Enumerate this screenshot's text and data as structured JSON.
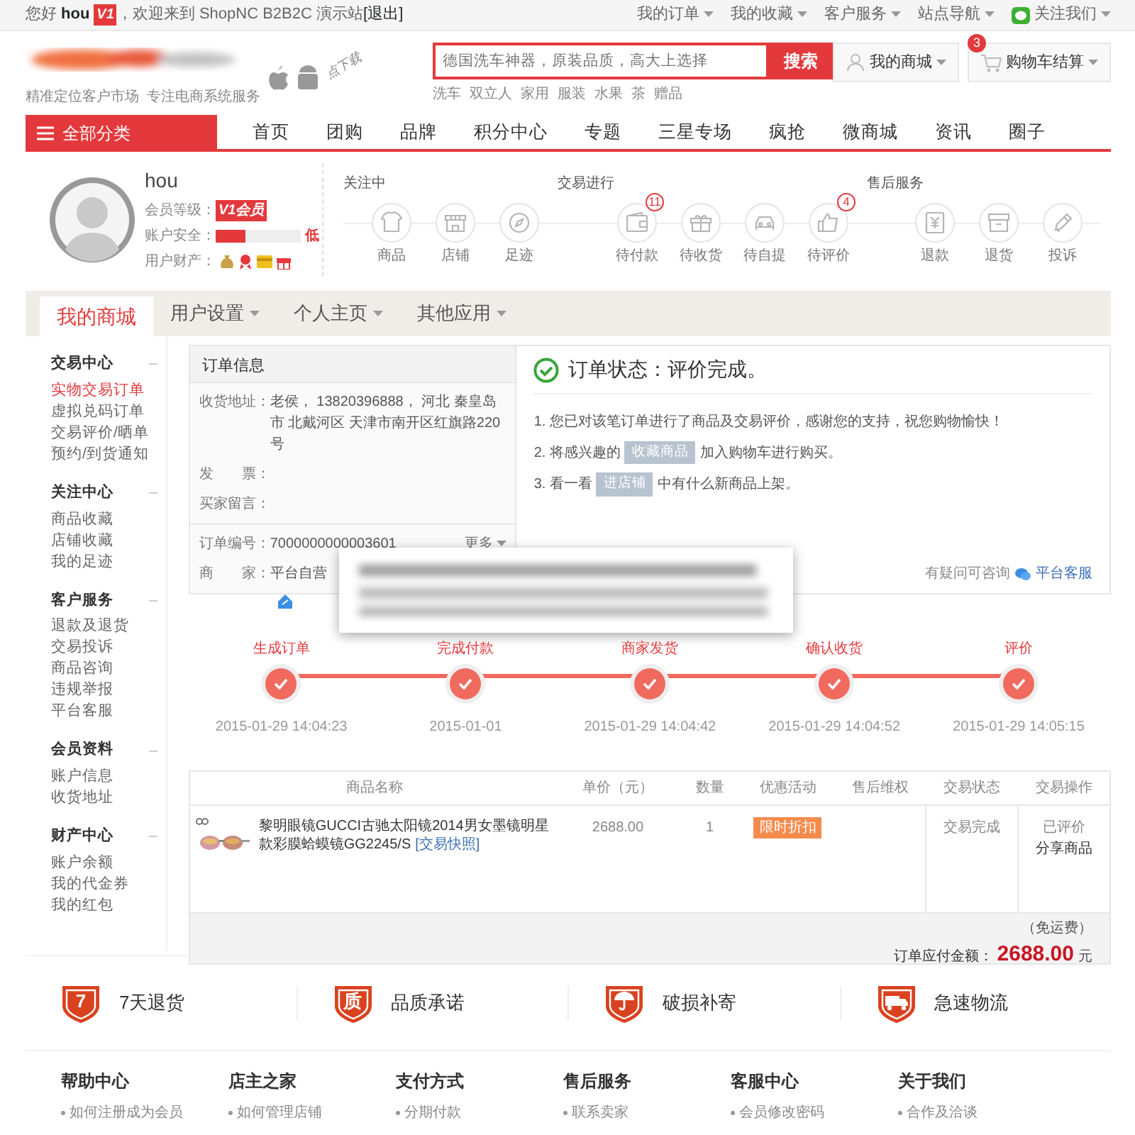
{
  "top_bar": {
    "greeting": "您好",
    "user": "hou",
    "level_badge": "V1",
    "welcome": "，欢迎来到 ShopNC B2B2C 演示站",
    "logout": "[退出]",
    "links": [
      "我的订单",
      "我的收藏",
      "客户服务",
      "站点导航"
    ],
    "follow": "关注我们"
  },
  "header": {
    "slogan": "精准定位客户市场  专注电商系统服务",
    "app_note": "点下载",
    "search": {
      "placeholder": "德国洗车神器，原装品质，高大上选择",
      "button": "搜索",
      "hot_words": [
        "洗车",
        "双立人",
        "家用",
        "服装",
        "水果",
        "茶",
        "赠品"
      ]
    },
    "my_mall": "我的商城",
    "cart": {
      "label": "购物车结算",
      "count": "3"
    }
  },
  "nav": {
    "category": "全部分类",
    "items": [
      "首页",
      "团购",
      "品牌",
      "积分中心",
      "专题",
      "三星专场",
      "疯抢",
      "微商城",
      "资讯",
      "圈子"
    ]
  },
  "profile": {
    "name": "hou",
    "level_label": "会员等级：",
    "level_badge": "V1会员",
    "security_label": "账户安全：",
    "security": {
      "level": 0.35,
      "reading": "低"
    },
    "assets_label": "用户财产："
  },
  "shortcut_groups": [
    {
      "title": "关注中",
      "items": [
        {
          "label": "商品",
          "kind": "shirt"
        },
        {
          "label": "店铺",
          "kind": "store"
        },
        {
          "label": "足迹",
          "kind": "compass"
        }
      ]
    },
    {
      "title": "交易进行",
      "items": [
        {
          "label": "待付款",
          "kind": "wallet",
          "count": "11"
        },
        {
          "label": "待收货",
          "kind": "gift"
        },
        {
          "label": "待自提",
          "kind": "car"
        },
        {
          "label": "待评价",
          "kind": "thumb",
          "count": "4"
        }
      ]
    },
    {
      "title": "售后服务",
      "items": [
        {
          "label": "退款",
          "kind": "refund"
        },
        {
          "label": "退货",
          "kind": "box"
        },
        {
          "label": "投诉",
          "kind": "pen"
        }
      ]
    }
  ],
  "tabs": [
    {
      "label": "我的商城",
      "selected": true,
      "dropdown": false
    },
    {
      "label": "用户设置",
      "selected": false,
      "dropdown": true
    },
    {
      "label": "个人主页",
      "selected": false,
      "dropdown": true
    },
    {
      "label": "其他应用",
      "selected": false,
      "dropdown": true
    }
  ],
  "sidebar": [
    {
      "title": "交易中心",
      "items": [
        {
          "label": "实物交易订单",
          "selected": true
        },
        {
          "label": "虚拟兑码订单",
          "selected": false
        },
        {
          "label": "交易评价/晒单",
          "selected": false
        },
        {
          "label": "预约/到货通知",
          "selected": false
        }
      ]
    },
    {
      "title": "关注中心",
      "items": [
        {
          "label": "商品收藏",
          "selected": false
        },
        {
          "label": "店铺收藏",
          "selected": false
        },
        {
          "label": "我的足迹",
          "selected": false
        }
      ]
    },
    {
      "title": "客户服务",
      "items": [
        {
          "label": "退款及退货",
          "selected": false
        },
        {
          "label": "交易投诉",
          "selected": false
        },
        {
          "label": "商品咨询",
          "selected": false
        },
        {
          "label": "违规举报",
          "selected": false
        },
        {
          "label": "平台客服",
          "selected": false
        }
      ]
    },
    {
      "title": "会员资料",
      "items": [
        {
          "label": "账户信息",
          "selected": false
        },
        {
          "label": "收货地址",
          "selected": false
        }
      ]
    },
    {
      "title": "财产中心",
      "items": [
        {
          "label": "账户余额",
          "selected": false
        },
        {
          "label": "我的代金券",
          "selected": false
        },
        {
          "label": "我的红包",
          "selected": false
        }
      ]
    }
  ],
  "order_info": {
    "title": "订单信息",
    "fields": [
      {
        "label": "收货地址：",
        "value": "老侯， 13820396888， 河北 秦皇岛市 北戴河区 天津市南开区红旗路220号"
      },
      {
        "label": "发　　票："
      },
      {
        "label": "买家留言："
      }
    ],
    "order_number": {
      "label": "订单编号：",
      "value": "7000000000003601",
      "more": "更多"
    },
    "seller": {
      "label": "商　　家：",
      "value": "平台自营"
    }
  },
  "order_status": {
    "title": "订单状态：评价完成。",
    "notes": [
      {
        "prefix": "1. 您已对该笔订单进行了商品及交易评价，感谢您的支持，祝您购物愉快！"
      },
      {
        "prefix": "2. 将感兴趣的",
        "button": "收藏商品",
        "suffix": "加入购物车进行购买。"
      },
      {
        "prefix": "3. 看一看",
        "button": "进店铺",
        "suffix": "中有什么新商品上架。"
      }
    ],
    "help": "有疑问可咨询",
    "service": "平台客服"
  },
  "progress": [
    {
      "label": "生成订单",
      "time": "2015-01-29 14:04:23",
      "done": true
    },
    {
      "label": "完成付款",
      "time": "2015-01-01",
      "done": true
    },
    {
      "label": "商家发货",
      "time": "2015-01-29 14:04:42",
      "done": true
    },
    {
      "label": "确认收货",
      "time": "2015-01-29 14:04:52",
      "done": true
    },
    {
      "label": "评价",
      "time": "2015-01-29 14:05:15",
      "done": true
    }
  ],
  "goods_table": {
    "columns": [
      "商品名称",
      "单价（元）",
      "数量",
      "优惠活动",
      "售后维权",
      "交易状态",
      "交易操作"
    ],
    "rows": [
      {
        "name": "黎明眼镜GUCCI古驰太阳镜2014男女墨镜明星款彩膜蛤蟆镜GG2245/S",
        "snapshot": "[交易快照]",
        "price": "2688.00",
        "quantity": "1",
        "promotion": "限时折扣",
        "status": "交易完成",
        "action_state": "已评价",
        "action": "分享商品"
      }
    ],
    "shipping": "（免运费）",
    "total_label": "订单应付金额：",
    "total": "2688.00",
    "currency": "元"
  },
  "guarantees": [
    {
      "kind": "glyph",
      "glyph": "7",
      "label": "7天退货"
    },
    {
      "kind": "glyph",
      "glyph": "质",
      "label": "品质承诺"
    },
    {
      "kind": "umbrella",
      "label": "破损补寄"
    },
    {
      "kind": "truck",
      "label": "急速物流"
    }
  ],
  "footer": [
    {
      "title": "帮助中心",
      "links": [
        "如何注册成为会员"
      ]
    },
    {
      "title": "店主之家",
      "links": [
        "如何管理店铺"
      ]
    },
    {
      "title": "支付方式",
      "links": [
        "分期付款"
      ]
    },
    {
      "title": "售后服务",
      "links": [
        "联系卖家"
      ]
    },
    {
      "title": "客服中心",
      "links": [
        "会员修改密码"
      ]
    },
    {
      "title": "关于我们",
      "links": [
        "合作及洽谈"
      ]
    }
  ]
}
